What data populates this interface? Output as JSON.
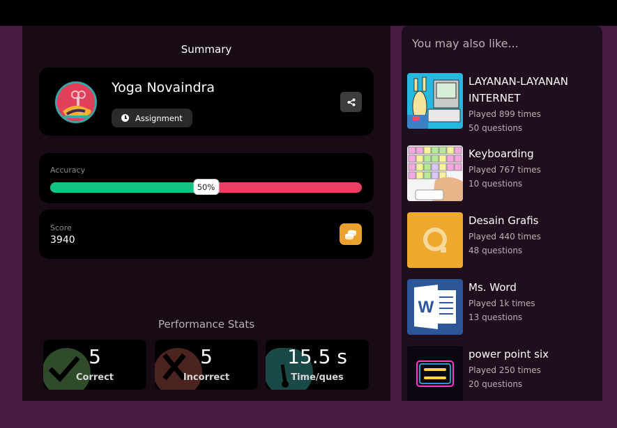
{
  "summary": {
    "title": "Summary"
  },
  "player": {
    "name": "Yoga Novaindra",
    "assignment_label": "Assignment"
  },
  "accuracy": {
    "label": "Accuracy",
    "percent_text": "50%",
    "value": 0.5
  },
  "score": {
    "label": "Score",
    "value": "3940"
  },
  "performance": {
    "title": "Performance Stats",
    "stats": [
      {
        "value": "5",
        "label": "Correct",
        "icon": "check-icon",
        "color": "#2f4b2a"
      },
      {
        "value": "5",
        "label": "Incorrect",
        "icon": "cross-icon",
        "color": "#4b231f"
      },
      {
        "value": "15.5 s",
        "label": "Time/ques",
        "icon": "stopwatch-icon",
        "color": "#1a4a48"
      }
    ]
  },
  "recommendations": {
    "title": "You may also like...",
    "items": [
      {
        "title": "LAYANAN-LAYANAN INTERNET",
        "played": "Played 899 times",
        "questions": "50 questions"
      },
      {
        "title": "Keyboarding",
        "played": "Played 767 times",
        "questions": "10 questions"
      },
      {
        "title": "Desain Grafis",
        "played": "Played 440 times",
        "questions": "48 questions"
      },
      {
        "title": "Ms. Word",
        "played": "Played 1k times",
        "questions": "13 questions"
      },
      {
        "title": "power point six",
        "played": "Played 250 times",
        "questions": "20 questions"
      }
    ]
  },
  "colors": {
    "correct": "#10c383",
    "incorrect": "#ec3d63",
    "coin": "#eba12e"
  }
}
